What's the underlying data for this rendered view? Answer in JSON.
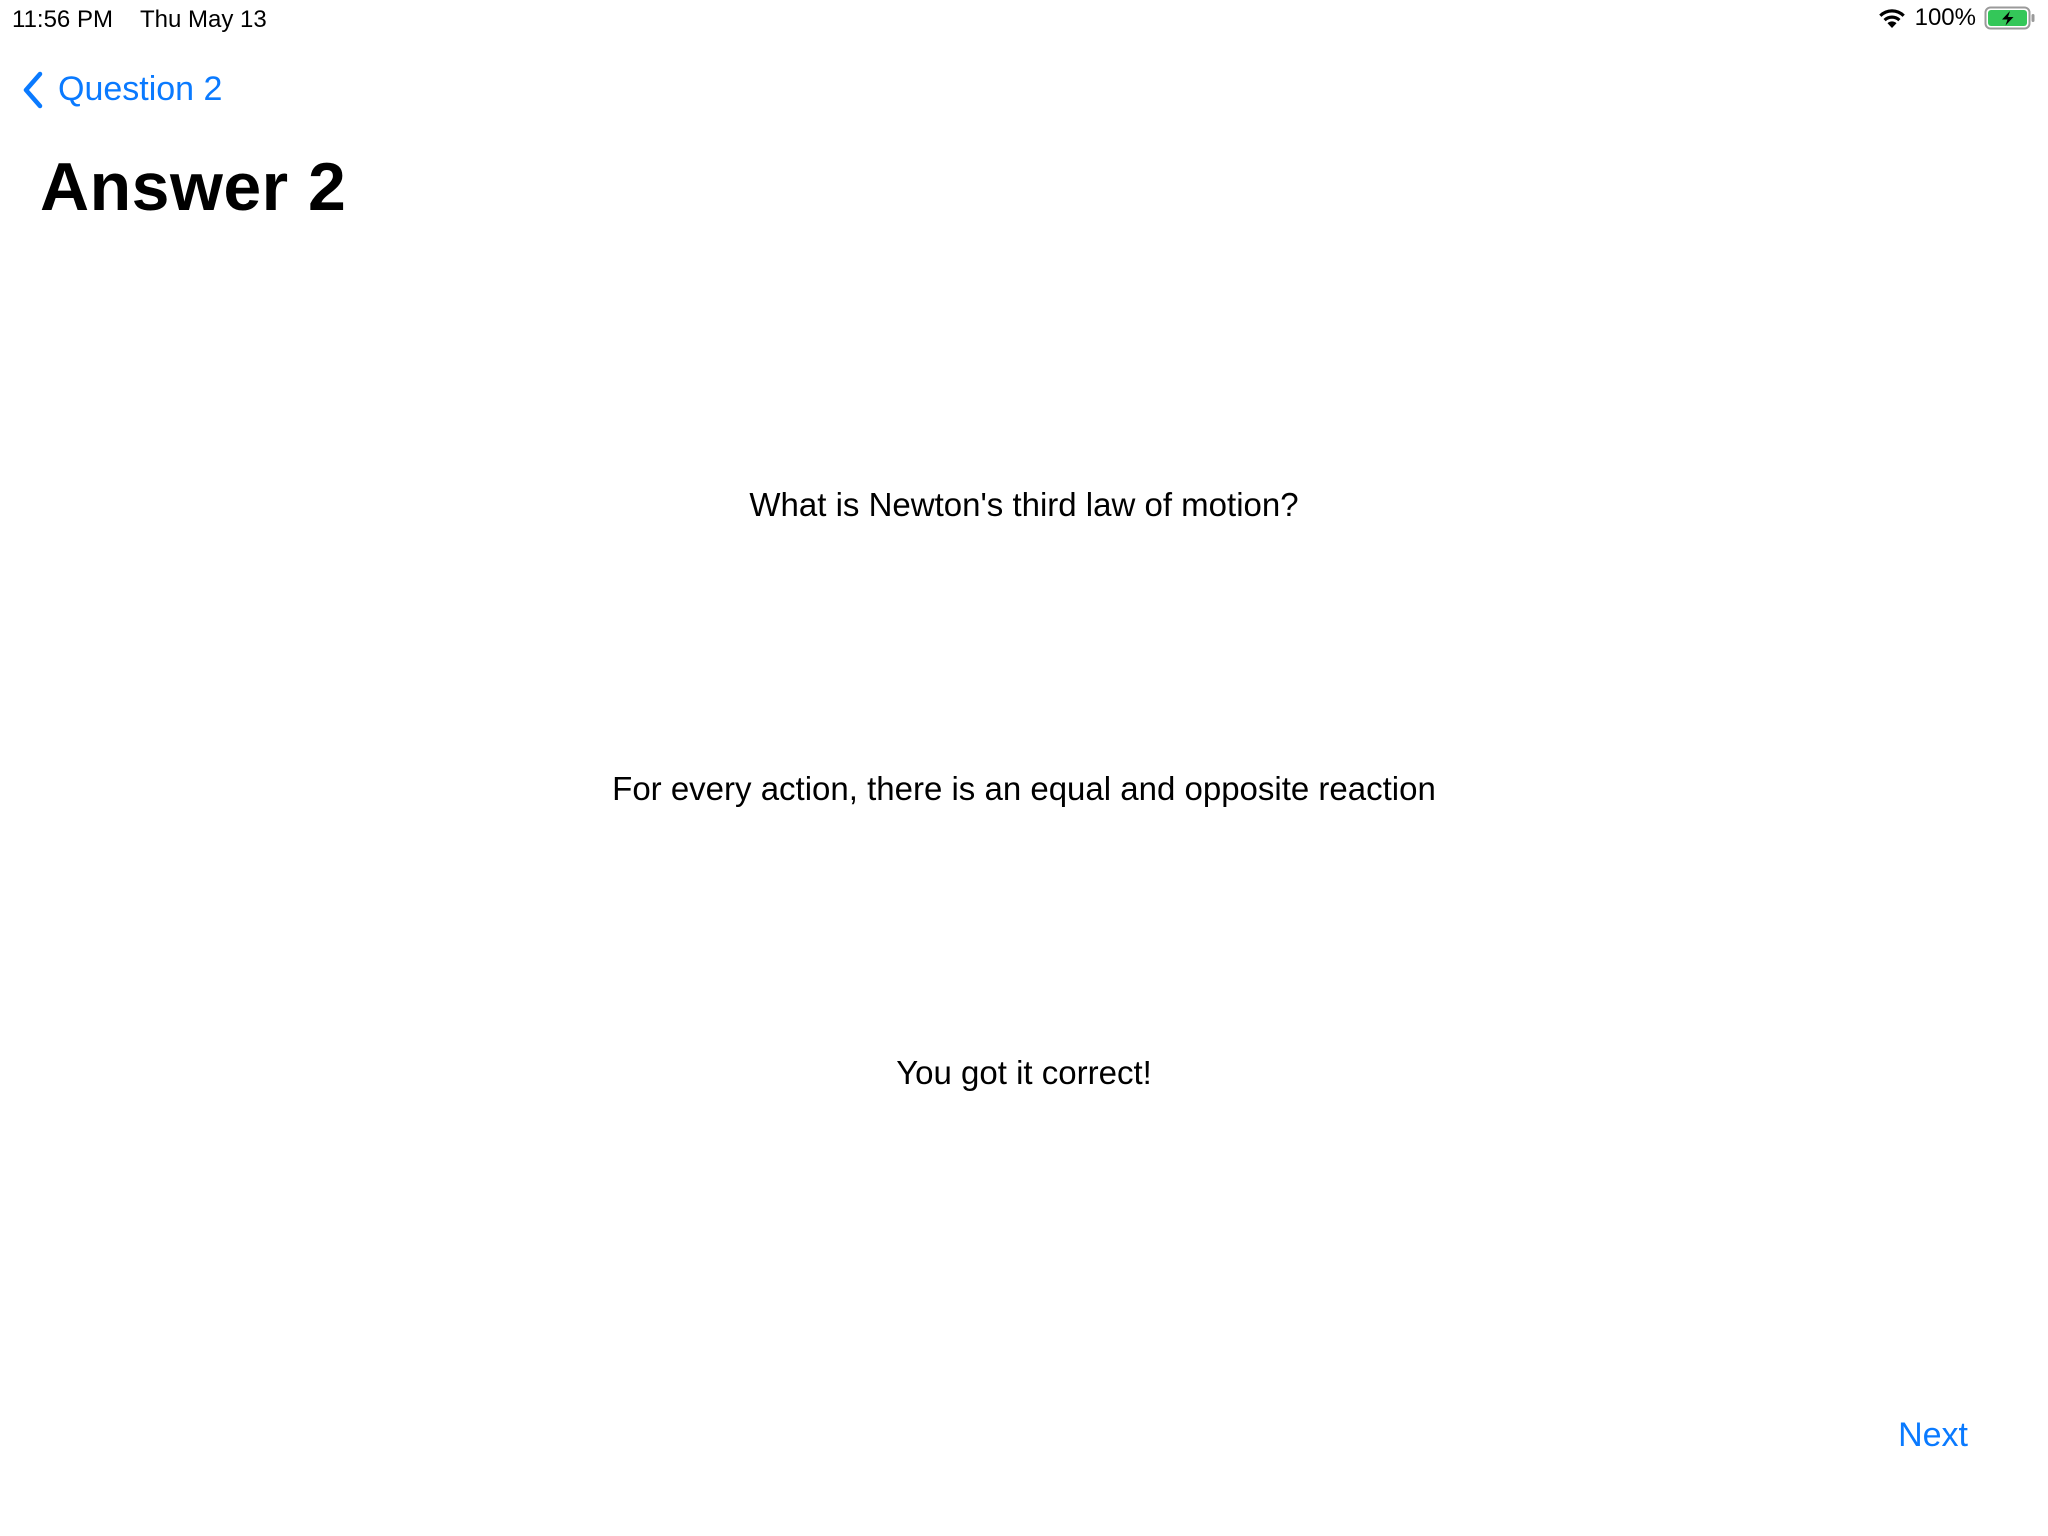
{
  "status_bar": {
    "time": "11:56 PM",
    "date": "Thu May 13",
    "battery_percent": "100%",
    "battery_color": "#34c759"
  },
  "nav": {
    "back_label": "Question 2",
    "accent_color": "#0a7aff"
  },
  "page": {
    "title": "Answer 2"
  },
  "content": {
    "question": "What is Newton's third law of motion?",
    "answer": "For every action, there is an equal and opposite reaction",
    "result": "You got it correct!"
  },
  "footer": {
    "next_label": "Next"
  }
}
